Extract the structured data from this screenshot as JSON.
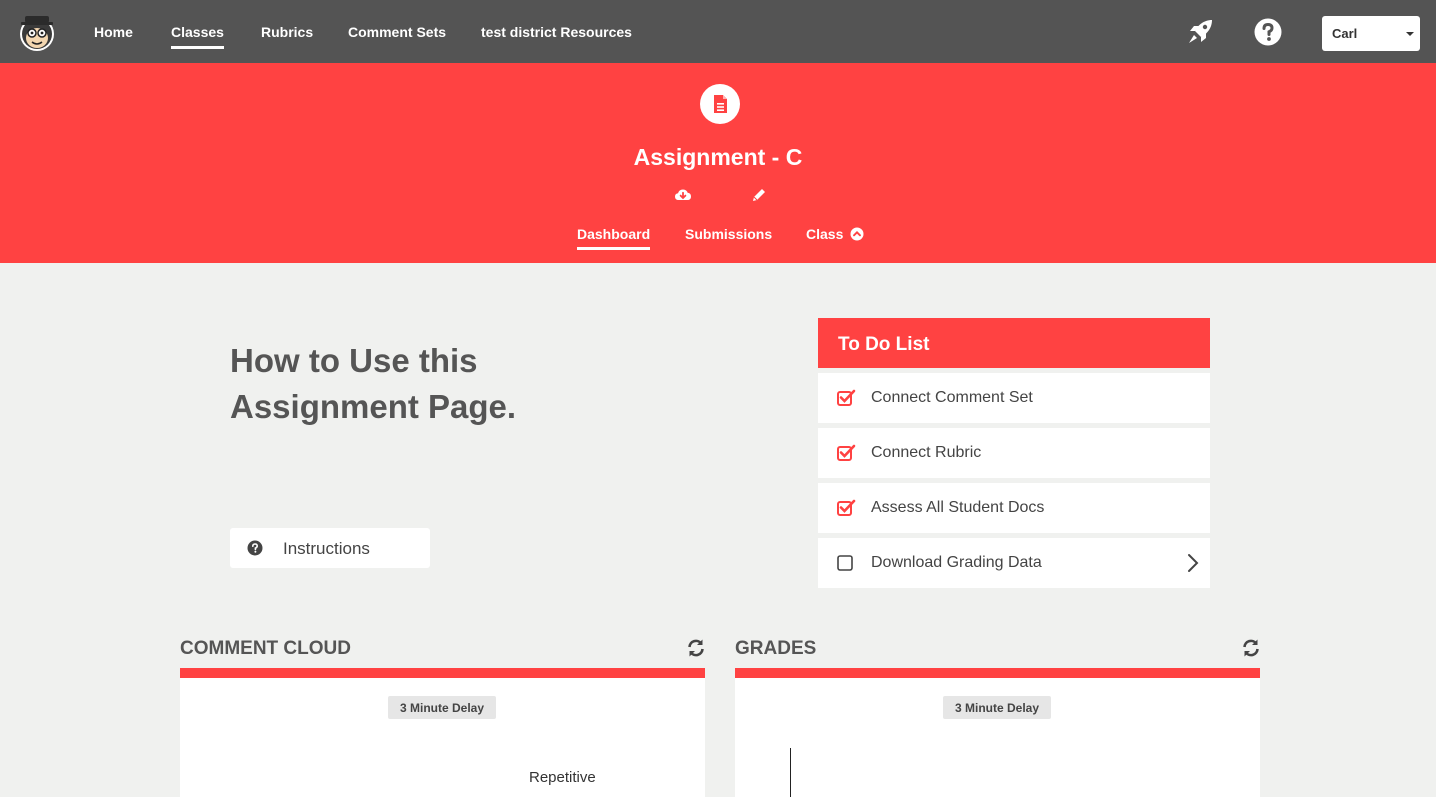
{
  "nav": {
    "items": [
      {
        "label": "Home",
        "active": false
      },
      {
        "label": "Classes",
        "active": true
      },
      {
        "label": "Rubrics",
        "active": false
      },
      {
        "label": "Comment Sets",
        "active": false
      },
      {
        "label": "test district Resources",
        "active": false
      }
    ],
    "icons": [
      "rocket-icon",
      "help-circle-icon"
    ],
    "user": {
      "selected": "Carl"
    }
  },
  "header": {
    "title": "Assignment - C",
    "icons": [
      "document-icon",
      "cloud-download-icon",
      "pencil-icon"
    ],
    "tabs": [
      {
        "label": "Dashboard",
        "active": true
      },
      {
        "label": "Submissions",
        "active": false
      },
      {
        "label": "Class",
        "active": false
      }
    ]
  },
  "howto": {
    "heading_line1": "How to Use this",
    "heading_line2": "Assignment Page.",
    "instructions_label": "Instructions"
  },
  "todo": {
    "title": "To Do List",
    "items": [
      {
        "label": "Connect Comment Set",
        "checked": true
      },
      {
        "label": "Connect Rubric",
        "checked": true
      },
      {
        "label": "Assess All Student Docs",
        "checked": true
      },
      {
        "label": "Download Grading Data",
        "checked": false
      }
    ]
  },
  "panels": {
    "comment_cloud": {
      "title": "COMMENT CLOUD",
      "delay": "3 Minute Delay",
      "words": [
        "Repetitive"
      ]
    },
    "grades": {
      "title": "GRADES",
      "delay": "3 Minute Delay"
    }
  },
  "colors": {
    "accent": "#ff4242",
    "nav_bg": "#545454",
    "page_bg": "#f0f1ef"
  }
}
